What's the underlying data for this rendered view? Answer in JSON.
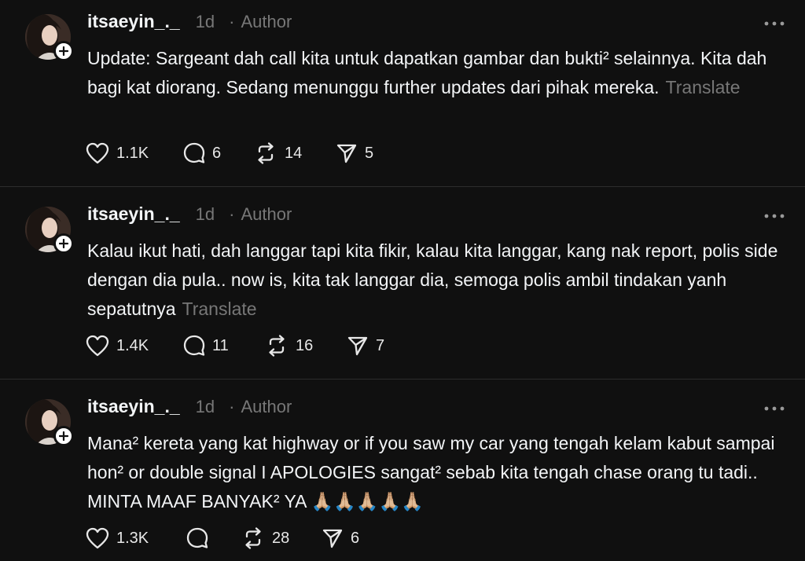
{
  "posts": [
    {
      "username": "itsaeyin_._",
      "time": "1d",
      "separator": "·",
      "role": "Author",
      "text": "Update: Sargeant dah call kita untuk dapatkan gambar dan bukti² selainnya. Kita dah bagi kat diorang. Sedang menunggu further updates dari pihak mereka.",
      "translate": "Translate",
      "likes": "1.1K",
      "replies": "6",
      "reposts": "14",
      "shares": "5"
    },
    {
      "username": "itsaeyin_._",
      "time": "1d",
      "separator": "·",
      "role": "Author",
      "text": "Kalau ikut hati, dah langgar tapi kita fikir, kalau kita langgar, kang nak report, polis side dengan dia pula.. now is, kita tak langgar dia, semoga polis ambil tindakan yanh sepatutnya",
      "translate": "Translate",
      "likes": "1.4K",
      "replies": "11",
      "reposts": "16",
      "shares": "7"
    },
    {
      "username": "itsaeyin_._",
      "time": "1d",
      "separator": "·",
      "role": "Author",
      "text": "Mana² kereta yang kat highway or if you saw my car yang tengah kelam kabut sampai hon² or double signal I APOLOGIES sangat² sebab kita tengah chase orang tu tadi.. MINTA MAAF BANYAK² YA 🙏🏼🙏🏼🙏🏼🙏🏼🙏🏼",
      "translate": "",
      "likes": "1.3K",
      "replies": "",
      "reposts": "28",
      "shares": "6"
    }
  ],
  "icons": {
    "like": "heart-icon",
    "reply": "comment-bubble-icon",
    "repost": "repost-arrows-icon",
    "share": "send-paper-plane-icon",
    "more": "more-horizontal-icon",
    "follow": "plus-icon"
  },
  "colors": {
    "background": "#101010",
    "text": "#f3f5f7",
    "muted": "#777777",
    "divider": "#2d2d2d"
  }
}
